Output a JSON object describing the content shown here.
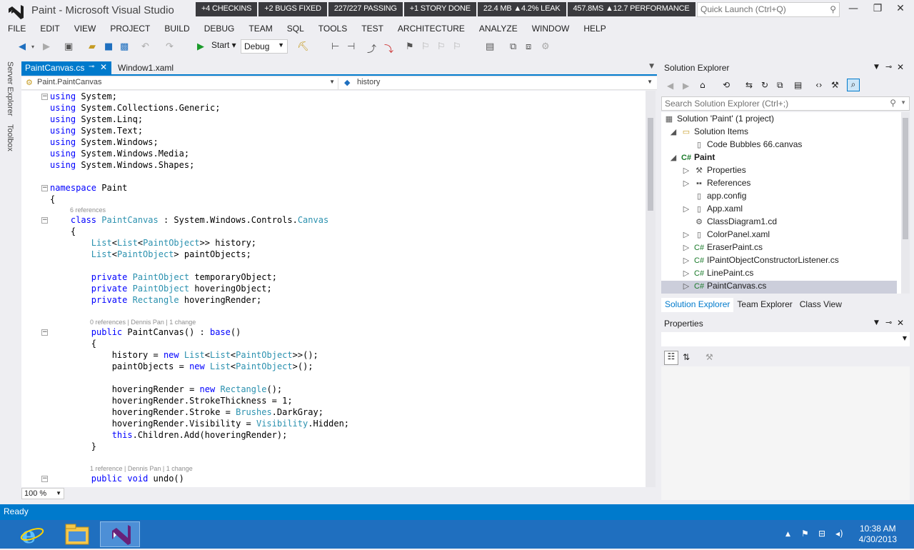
{
  "window": {
    "title": "Paint - Microsoft Visual Studio",
    "stats": [
      "+4 CHECKINS",
      "+2 BUGS FIXED",
      "227/227 PASSING",
      "+1 STORY DONE",
      "22.4 MB ▲4.2% LEAK",
      "457.8MS ▲12.7 PERFORMANCE"
    ],
    "quick_launch_placeholder": "Quick Launch (Ctrl+Q)"
  },
  "menu": [
    "FILE",
    "EDIT",
    "VIEW",
    "PROJECT",
    "BUILD",
    "DEBUG",
    "TEAM",
    "SQL",
    "TOOLS",
    "TEST",
    "ARCHITECTURE",
    "ANALYZE",
    "WINDOW",
    "HELP"
  ],
  "toolbar": {
    "start_label": "Start",
    "configuration": "Debug"
  },
  "left_rail": {
    "server_explorer": "Server Explorer",
    "toolbox": "Toolbox"
  },
  "editor": {
    "tabs": [
      {
        "label": "PaintCanvas.cs",
        "active": true
      },
      {
        "label": "Window1.xaml",
        "active": false
      }
    ],
    "nav_type": "Paint.PaintCanvas",
    "nav_member": "history",
    "zoom": "100 %",
    "lines": [
      "using System;",
      "using System.Collections.Generic;",
      "using System.Linq;",
      "using System.Text;",
      "using System.Windows;",
      "using System.Windows.Media;",
      "using System.Windows.Shapes;",
      "",
      "namespace Paint",
      "{",
      "    class PaintCanvas : System.Windows.Controls.Canvas",
      "    {",
      "        List<List<PaintObject>> history;",
      "        List<PaintObject> paintObjects;",
      "",
      "        private PaintObject temporaryObject;",
      "        private PaintObject hoveringObject;",
      "        private Rectangle hoveringRender;",
      "",
      "        public PaintCanvas() : base()",
      "        {",
      "            history = new List<List<PaintObject>>();",
      "            paintObjects = new List<PaintObject>();",
      "",
      "            hoveringRender = new Rectangle();",
      "            hoveringRender.StrokeThickness = 1;",
      "            hoveringRender.Stroke = Brushes.DarkGray;",
      "            hoveringRender.Visibility = Visibility.Hidden;",
      "            this.Children.Add(hoveringRender);",
      "        }",
      "",
      "        public void undo()"
    ],
    "lens": [
      "6 references",
      "0 references | Dennis Pan | 1 change",
      "1 reference | Dennis Pan | 1 change"
    ]
  },
  "solution_explorer": {
    "title": "Solution Explorer",
    "search_placeholder": "Search Solution Explorer (Ctrl+;)",
    "items": [
      {
        "label": "Solution 'Paint' (1 project)",
        "icon": "solution-icon"
      },
      {
        "label": "Solution Items",
        "icon": "folder-icon"
      },
      {
        "label": "Code Bubbles 66.canvas",
        "icon": "file-icon"
      },
      {
        "label": "Paint",
        "icon": "csharp-project-icon"
      },
      {
        "label": "Properties",
        "icon": "wrench-icon"
      },
      {
        "label": "References",
        "icon": "references-icon"
      },
      {
        "label": "app.config",
        "icon": "config-file-icon"
      },
      {
        "label": "App.xaml",
        "icon": "xaml-file-icon"
      },
      {
        "label": "ClassDiagram1.cd",
        "icon": "class-diagram-icon"
      },
      {
        "label": "ColorPanel.xaml",
        "icon": "xaml-file-icon"
      },
      {
        "label": "EraserPaint.cs",
        "icon": "csharp-file-icon"
      },
      {
        "label": "IPaintObjectConstructorListener.cs",
        "icon": "csharp-file-icon"
      },
      {
        "label": "LinePaint.cs",
        "icon": "csharp-file-icon"
      },
      {
        "label": "PaintCanvas.cs",
        "icon": "csharp-file-icon"
      }
    ],
    "bottom_tabs": [
      "Solution Explorer",
      "Team Explorer",
      "Class View"
    ]
  },
  "properties": {
    "title": "Properties"
  },
  "status": {
    "text": "Ready"
  },
  "taskbar": {
    "time": "10:38 AM",
    "date": "4/30/2013"
  },
  "colors": {
    "accent": "#007acc",
    "keyword": "#0000ff",
    "type": "#2b91af",
    "taskbar": "#1f6fbf"
  }
}
